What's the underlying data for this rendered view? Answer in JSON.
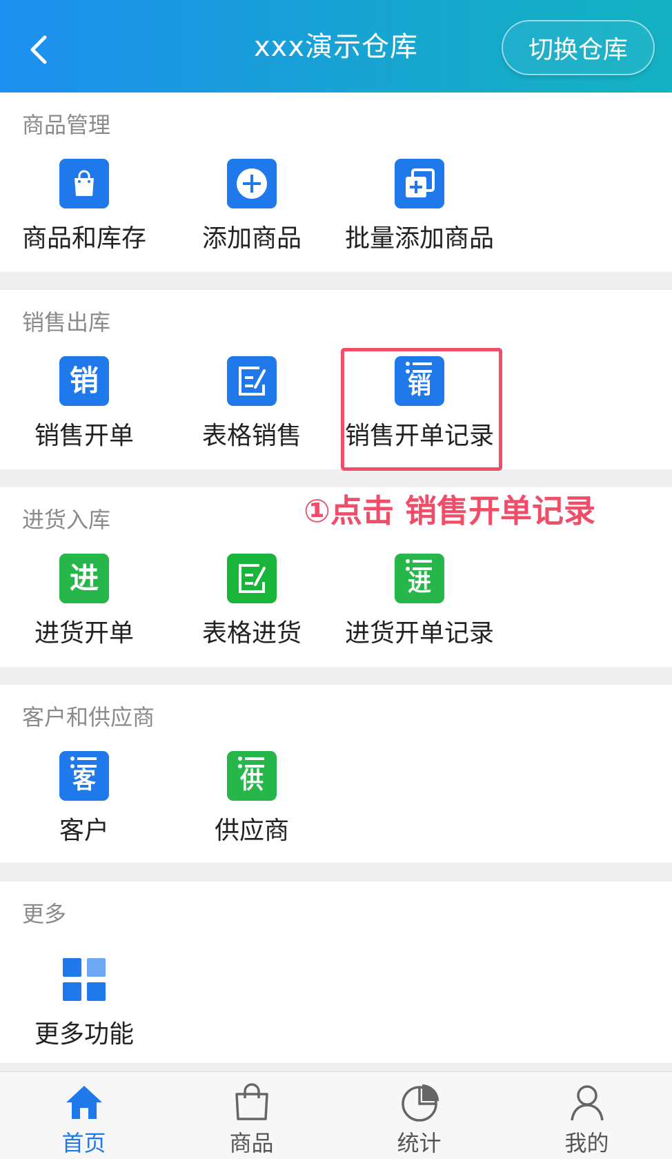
{
  "header": {
    "title": "xxx演示仓库",
    "switch_label": "切换仓库"
  },
  "sections": [
    {
      "title": "商品管理",
      "items": [
        {
          "label": "商品和库存",
          "icon": "shopping-bag-icon"
        },
        {
          "label": "添加商品",
          "icon": "plus-circle-icon"
        },
        {
          "label": "批量添加商品",
          "icon": "batch-add-icon"
        }
      ]
    },
    {
      "title": "销售出库",
      "items": [
        {
          "label": "销售开单",
          "icon_char": "销"
        },
        {
          "label": "表格销售",
          "icon": "edit-form-icon"
        },
        {
          "label": "销售开单记录",
          "icon_char": "销"
        }
      ]
    },
    {
      "title": "进货入库",
      "items": [
        {
          "label": "进货开单",
          "icon_char": "进"
        },
        {
          "label": "表格进货",
          "icon": "edit-form-icon"
        },
        {
          "label": "进货开单记录",
          "icon_char": "进"
        }
      ]
    },
    {
      "title": "客户和供应商",
      "items": [
        {
          "label": "客户",
          "icon_char": "客"
        },
        {
          "label": "供应商",
          "icon_char": "供"
        }
      ]
    },
    {
      "title": "更多",
      "items": [
        {
          "label": "更多功能",
          "icon": "grid-apps-icon"
        }
      ]
    }
  ],
  "annotation": "①点击 销售开单记录",
  "tabs": [
    {
      "label": "首页",
      "active": true
    },
    {
      "label": "商品",
      "active": false
    },
    {
      "label": "统计",
      "active": false
    },
    {
      "label": "我的",
      "active": false
    }
  ],
  "colors": {
    "blue": "#1f79ea",
    "green": "#26b64a",
    "highlight": "#ef4d68"
  }
}
